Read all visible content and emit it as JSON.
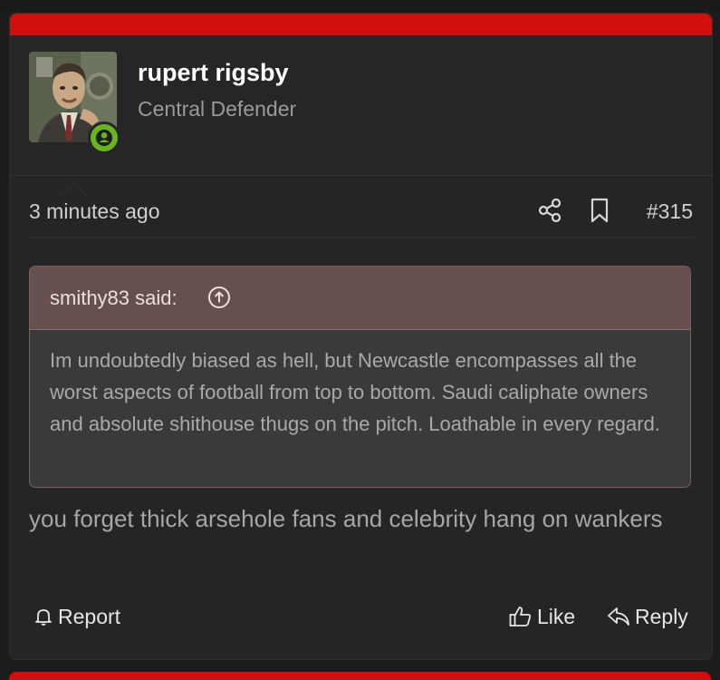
{
  "post": {
    "author": {
      "name": "rupert rigsby",
      "title": "Central Defender",
      "online": true
    },
    "timestamp": "3 minutes ago",
    "post_number": "#315",
    "quote": {
      "author_label": "smithy83 said:",
      "text": "Im undoubtedly biased as hell, but Newcastle encompasses all the worst aspects of football from top to bottom. Saudi caliphate owners and absolute shithouse thugs on the pitch. Loathable in every regard."
    },
    "body": "you forget thick arsehole fans and celebrity hang on wankers",
    "actions": {
      "report": "Report",
      "like": "Like",
      "reply": "Reply"
    }
  },
  "icons": {
    "share": "share-icon",
    "bookmark": "bookmark-icon",
    "quote_jump": "arrow-up-circle-icon",
    "report": "bell-icon",
    "like": "thumbs-up-icon",
    "reply": "reply-arrow-icon",
    "online": "user-online-icon"
  },
  "colors": {
    "accent_red": "#d10f0f",
    "online_green": "#69b51f",
    "quote_header": "#674f4e",
    "quote_border": "#7a6160",
    "card_background": "#252525"
  }
}
